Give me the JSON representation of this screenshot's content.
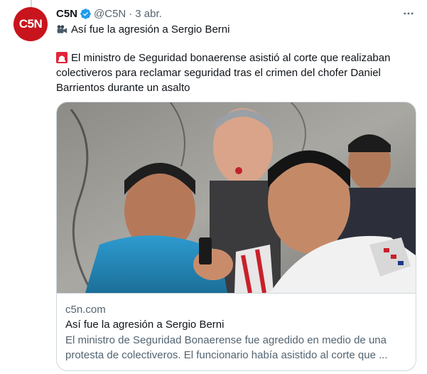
{
  "tweet": {
    "author_name": "C5N",
    "avatar_text": "C5N",
    "handle": "@C5N",
    "separator": "·",
    "date": "3 abr.",
    "headline": "Así fue la agresión a Sergio Berni",
    "body_lines": [
      "El ministro de Seguridad bonaerense asistió al corte que realizaban",
      "colectiveros para reclamar seguridad tras el crimen del chofer Daniel",
      "Barrientos durante un asalto"
    ]
  },
  "card": {
    "domain": "c5n.com",
    "title": "Así fue la agresión a Sergio Berni",
    "description_lines": [
      "El ministro de Seguridad Bonaerense fue agredido en medio de una",
      "protesta de colectiveros. El funcionario había asistido al corte que ..."
    ]
  },
  "icons": {
    "verified": "verified-badge-icon",
    "more": "more-options-icon",
    "camera": "movie-camera-icon",
    "siren": "siren-icon"
  },
  "colors": {
    "brand": "#c8141d",
    "verified": "#1d9bf0",
    "secondary_text": "#536471",
    "border": "#cfd9de"
  }
}
